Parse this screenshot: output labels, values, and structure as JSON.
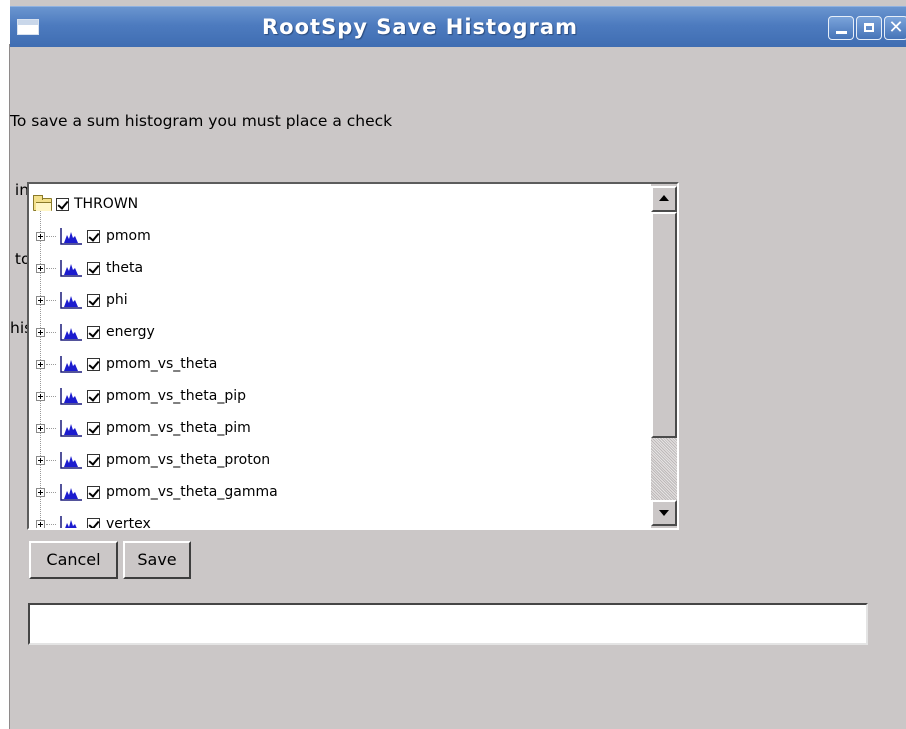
{
  "window": {
    "title": "RootSpy Save Histogram",
    "minimize_label": "",
    "maximize_label": "",
    "close_label": "✕"
  },
  "instructions": [
    "To save a sum histogram you must place a check",
    " in a box located under the histogram name. This check corresponds",
    " to which servers you will include in the sum",
    "histogram .root file, if any."
  ],
  "tree": {
    "root": {
      "label": "THROWN",
      "checked": true,
      "icon": "folder-icon"
    },
    "items": [
      {
        "label": "pmom",
        "checked": true,
        "icon": "histogram-icon"
      },
      {
        "label": "theta",
        "checked": true,
        "icon": "histogram-icon"
      },
      {
        "label": "phi",
        "checked": true,
        "icon": "histogram-icon"
      },
      {
        "label": "energy",
        "checked": true,
        "icon": "histogram-icon"
      },
      {
        "label": "pmom_vs_theta",
        "checked": true,
        "icon": "histogram-icon"
      },
      {
        "label": "pmom_vs_theta_pip",
        "checked": true,
        "icon": "histogram-icon"
      },
      {
        "label": "pmom_vs_theta_pim",
        "checked": true,
        "icon": "histogram-icon"
      },
      {
        "label": "pmom_vs_theta_proton",
        "checked": true,
        "icon": "histogram-icon"
      },
      {
        "label": "pmom_vs_theta_gamma",
        "checked": true,
        "icon": "histogram-icon"
      },
      {
        "label": "vertex",
        "checked": true,
        "icon": "histogram-icon"
      }
    ]
  },
  "buttons": {
    "cancel_label": "Cancel",
    "save_label": "Save"
  },
  "status_field": {
    "value": ""
  },
  "colors": {
    "window_bg": "#cbc7c7",
    "titlebar": "#4d7bbf",
    "histogram_fill": "#1c1ccf"
  }
}
